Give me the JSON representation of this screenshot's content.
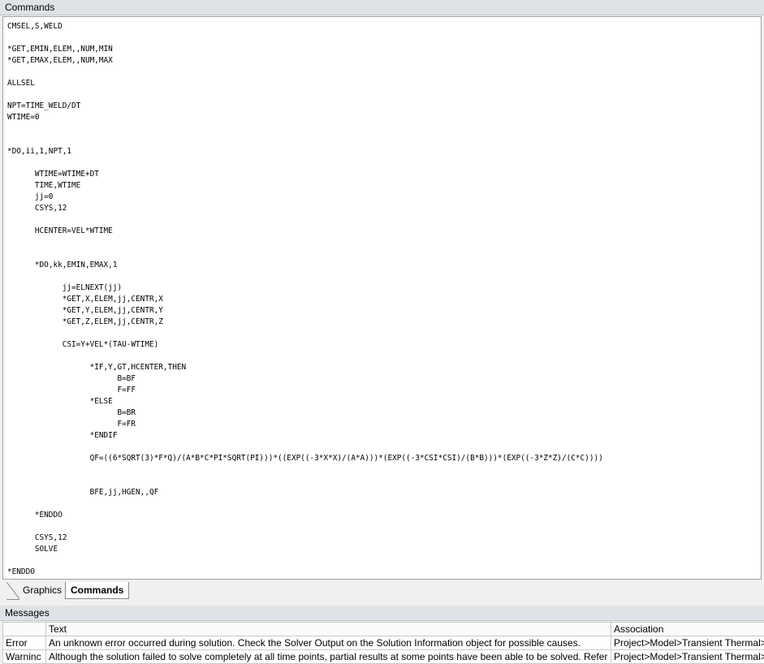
{
  "commands_panel": {
    "title": "Commands"
  },
  "code": {
    "lines": [
      "CMSEL,S,WELD",
      "",
      "*GET,EMIN,ELEM,,NUM,MIN",
      "*GET,EMAX,ELEM,,NUM,MAX",
      "",
      "ALLSEL",
      "",
      "NPT=TIME_WELD/DT",
      "WTIME=0",
      "",
      "",
      "*DO,ii,1,NPT,1",
      "",
      "      WTIME=WTIME+DT",
      "      TIME,WTIME",
      "      jj=0",
      "      CSYS,12",
      "",
      "      HCENTER=VEL*WTIME",
      "",
      "",
      "      *DO,kk,EMIN,EMAX,1",
      "",
      "            jj=ELNEXT(jj)",
      "            *GET,X,ELEM,jj,CENTR,X",
      "            *GET,Y,ELEM,jj,CENTR,Y",
      "            *GET,Z,ELEM,jj,CENTR,Z",
      "",
      "            CSI=Y+VEL*(TAU-WTIME)",
      "",
      "                  *IF,Y,GT,HCENTER,THEN",
      "                        B=BF",
      "                        F=FF",
      "                  *ELSE",
      "                        B=BR",
      "                        F=FR",
      "                  *ENDIF",
      "",
      "                  QF=((6*SQRT(3)*F*Q)/(A*B*C*PI*SQRT(PI)))*((EXP((-3*X*X)/(A*A)))*(EXP((-3*CSI*CSI)/(B*B)))*(EXP((-3*Z*Z)/(C*C))))",
      "",
      "",
      "                  BFE,jj,HGEN,,QF",
      "",
      "      *ENDDO",
      "",
      "      CSYS,12",
      "      SOLVE",
      "",
      "*ENDDO"
    ]
  },
  "tabs": [
    {
      "label": "Graphics",
      "active": false
    },
    {
      "label": "Commands",
      "active": true
    }
  ],
  "messages_panel": {
    "title": "Messages",
    "columns": [
      "",
      "Text",
      "Association"
    ],
    "rows": [
      {
        "type": "Error",
        "text": "An unknown error occurred during solution.  Check the Solver Output on the Solution Information object for possible causes.",
        "association": "Project>Model>Transient Thermal>"
      },
      {
        "type": "Warninc",
        "text": "Although the solution failed to solve completely at all time points, partial results at some points have been able to be solved.  Refer",
        "association": "Project>Model>Transient Thermal>"
      }
    ]
  }
}
